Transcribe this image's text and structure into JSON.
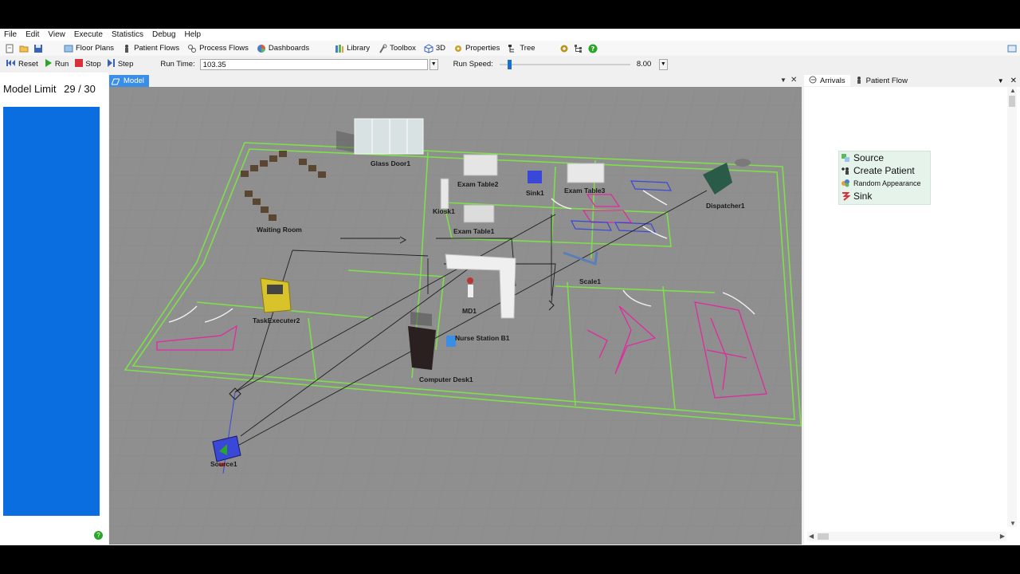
{
  "menu": [
    "File",
    "Edit",
    "View",
    "Execute",
    "Statistics",
    "Debug",
    "Help"
  ],
  "toolbar": {
    "buttons": [
      {
        "label": "Floor Plans",
        "icon": "floor-plans-icon"
      },
      {
        "label": "Patient Flows",
        "icon": "patient-flows-icon"
      },
      {
        "label": "Process Flows",
        "icon": "process-flows-icon"
      },
      {
        "label": "Dashboards",
        "icon": "dashboards-icon"
      },
      {
        "label": "Library",
        "icon": "library-icon"
      },
      {
        "label": "Toolbox",
        "icon": "toolbox-icon"
      },
      {
        "label": "3D",
        "icon": "3d-icon"
      },
      {
        "label": "Properties",
        "icon": "properties-icon"
      },
      {
        "label": "Tree",
        "icon": "tree-icon"
      }
    ]
  },
  "runbar": {
    "reset": "Reset",
    "run": "Run",
    "stop": "Stop",
    "step": "Step",
    "run_time_label": "Run Time:",
    "run_time_value": "103.35",
    "run_speed_label": "Run Speed:",
    "run_speed_value": "8.00",
    "run_speed_fraction": 0.06
  },
  "left_panel": {
    "title": "Model Limit",
    "count": "29 / 30",
    "fill_fraction": 0.967
  },
  "model_tab": {
    "label": "Model"
  },
  "objects": [
    {
      "id": "glass-door",
      "label": "Glass Door1"
    },
    {
      "id": "exam-table-2",
      "label": "Exam Table2"
    },
    {
      "id": "sink",
      "label": "Sink1"
    },
    {
      "id": "exam-table-3",
      "label": "Exam Table3"
    },
    {
      "id": "kiosk",
      "label": "Kiosk1"
    },
    {
      "id": "exam-table-1",
      "label": "Exam Table1"
    },
    {
      "id": "dispatcher",
      "label": "Dispatcher1"
    },
    {
      "id": "waiting-room",
      "label": "Waiting Room"
    },
    {
      "id": "scale",
      "label": "Scale1"
    },
    {
      "id": "task-executer",
      "label": "TaskExecuter2"
    },
    {
      "id": "md",
      "label": "MD1"
    },
    {
      "id": "nurse-station",
      "label": "Nurse Station B1"
    },
    {
      "id": "computer-desk",
      "label": "Computer Desk1"
    },
    {
      "id": "source",
      "label": "Source1"
    }
  ],
  "right_panel": {
    "tabs": [
      {
        "label": "Arrivals",
        "icon": "arrivals-icon"
      },
      {
        "label": "Patient Flow",
        "icon": "patient-flow-icon"
      }
    ],
    "items": [
      {
        "label": "Source",
        "icon": "source-icon",
        "size": "normal"
      },
      {
        "label": "Create Patient",
        "icon": "create-patient-icon",
        "size": "normal"
      },
      {
        "label": "Random Appearance",
        "icon": "random-appearance-icon",
        "size": "small"
      },
      {
        "label": "Sink",
        "icon": "sink-icon",
        "size": "normal"
      }
    ]
  },
  "colors": {
    "accent_blue": "#0a6de0",
    "tab_blue": "#3a8ee6",
    "floor_gray": "#8f8f8f",
    "wall_green": "#7de04a",
    "magenta": "#e02aa0",
    "list_bg": "#e6f3ea"
  }
}
